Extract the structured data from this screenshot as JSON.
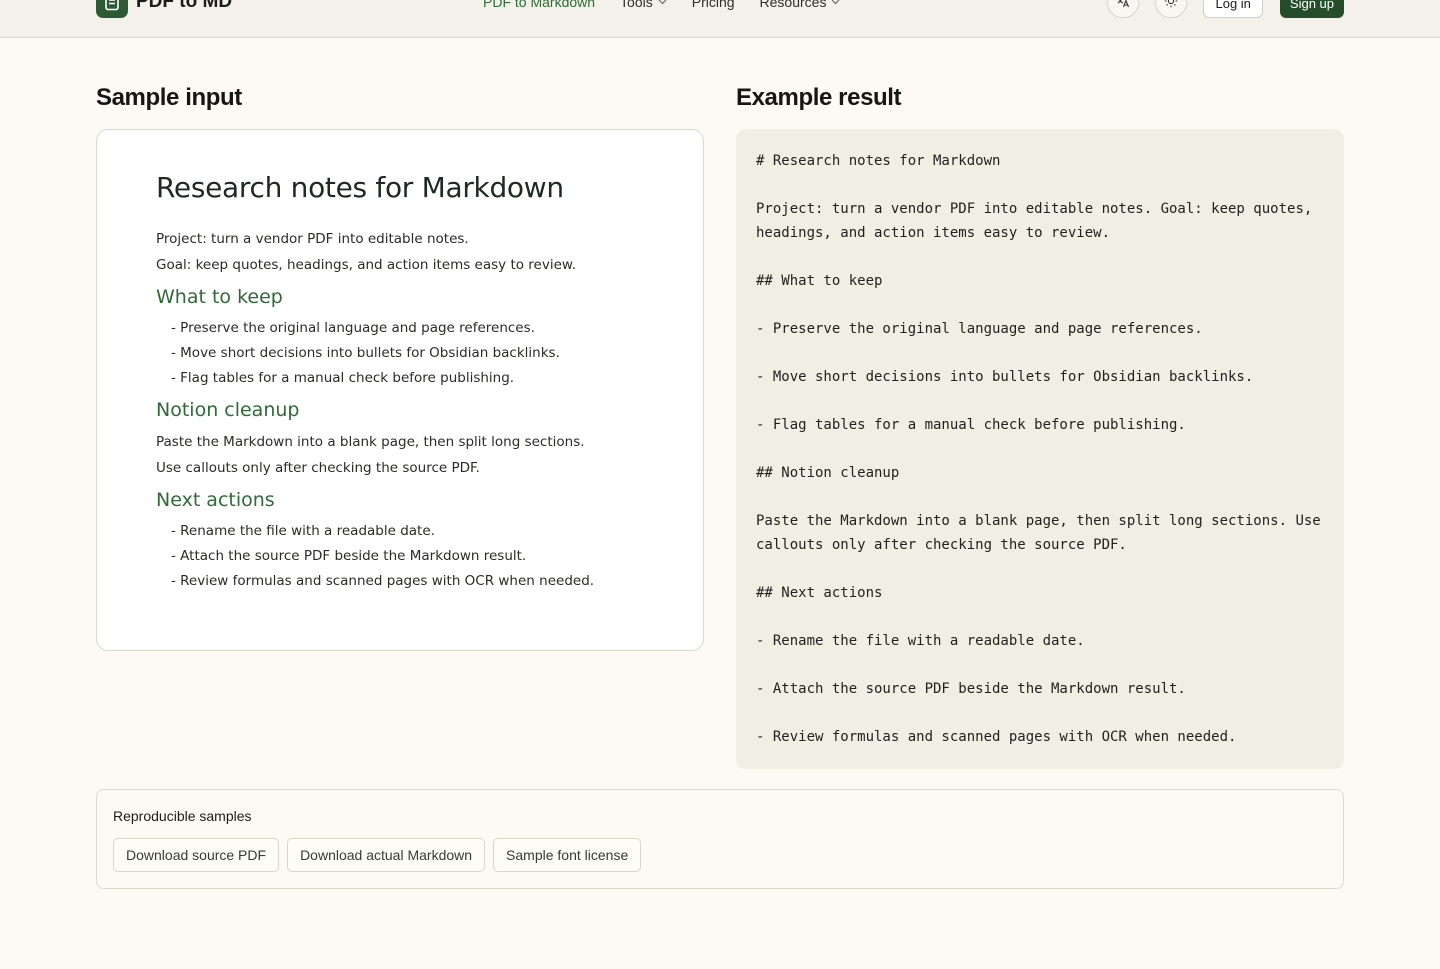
{
  "header": {
    "brand": "PDF to MD",
    "nav": [
      {
        "label": "PDF to Markdown",
        "active": true,
        "dropdown": false
      },
      {
        "label": "Tools",
        "active": false,
        "dropdown": true
      },
      {
        "label": "Pricing",
        "active": false,
        "dropdown": false
      },
      {
        "label": "Resources",
        "active": false,
        "dropdown": true
      }
    ],
    "language_icon": "translate-icon",
    "theme_icon": "sun-icon",
    "login_label": "Log in",
    "signup_label": "Sign up"
  },
  "sample": {
    "heading": "Sample input",
    "doc": {
      "title": "Research notes for Markdown",
      "intro": [
        "Project: turn a vendor PDF into editable notes.",
        "Goal: keep quotes, headings, and action items easy to review."
      ],
      "section1_title": "What to keep",
      "section1_items": [
        "- Preserve the original language and page references.",
        "- Move short decisions into bullets for Obsidian backlinks.",
        "- Flag tables for a manual check before publishing."
      ],
      "section2_title": "Notion cleanup",
      "section2_paras": [
        "Paste the Markdown into a blank page, then split long sections.",
        "Use callouts only after checking the source PDF."
      ],
      "section3_title": "Next actions",
      "section3_items": [
        "- Rename the file with a readable date.",
        "- Attach the source PDF beside the Markdown result.",
        "- Review formulas and scanned pages with OCR when needed."
      ]
    }
  },
  "result": {
    "heading": "Example result",
    "lines": [
      "# Research notes for Markdown",
      "",
      "Project: turn a vendor PDF into editable notes. Goal: keep quotes, headings, and action items easy to review.",
      "",
      "## What to keep",
      "",
      "- Preserve the original language and page references.",
      "",
      "- Move short decisions into bullets for Obsidian backlinks.",
      "",
      "- Flag tables for a manual check before publishing.",
      "",
      "## Notion cleanup",
      "",
      "Paste the Markdown into a blank page, then split long sections. Use callouts only after checking the source PDF.",
      "",
      "## Next actions",
      "",
      "- Rename the file with a readable date.",
      "",
      "- Attach the source PDF beside the Markdown result.",
      "",
      "- Review formulas and scanned pages with OCR when needed."
    ]
  },
  "repro": {
    "title": "Reproducible samples",
    "buttons": [
      "Download source PDF",
      "Download actual Markdown",
      "Sample font license"
    ]
  },
  "colors": {
    "accent": "#2e6b37",
    "brand_dark": "#264d2b",
    "background": "#fcfaf2",
    "code_panel": "#f0efe3"
  }
}
